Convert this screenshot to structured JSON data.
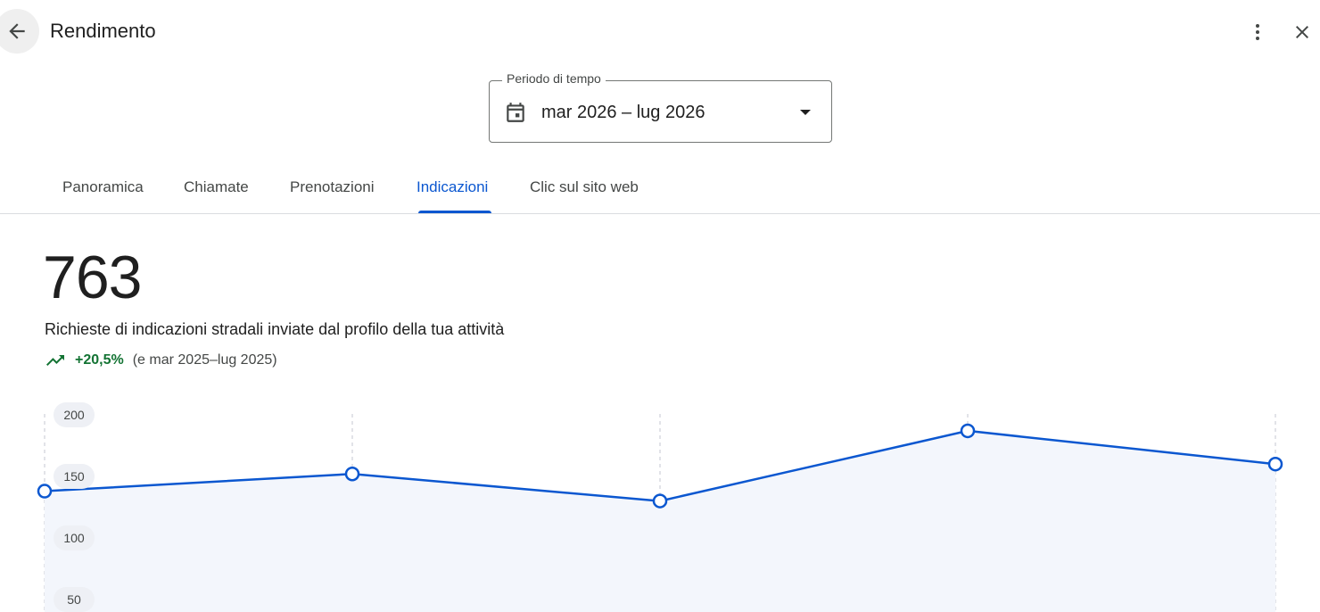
{
  "header": {
    "title": "Rendimento",
    "back_icon": "arrow-left-icon",
    "more_icon": "more-vertical-icon",
    "close_icon": "close-icon"
  },
  "period": {
    "label": "Periodo di tempo",
    "value": "mar 2026 – lug 2026",
    "icon": "calendar-icon"
  },
  "tabs": [
    {
      "label": "Panoramica",
      "active": false
    },
    {
      "label": "Chiamate",
      "active": false
    },
    {
      "label": "Prenotazioni",
      "active": false
    },
    {
      "label": "Indicazioni",
      "active": true
    },
    {
      "label": "Clic sul sito web",
      "active": false
    }
  ],
  "summary": {
    "total": "763",
    "description": "Richieste di indicazioni stradali inviate dal profilo della tua attività",
    "trend_icon": "trending-up-icon",
    "change": "+20,5%",
    "comparison": "(e mar 2025–lug 2025)"
  },
  "colors": {
    "accent": "#0b57d0",
    "positive": "#137333",
    "area_fill": "#f3f6fc",
    "grid": "#c4c7d0"
  },
  "chart_data": {
    "type": "area",
    "x": [
      1,
      2,
      3,
      4,
      5
    ],
    "values": [
      138,
      152,
      130,
      187,
      160
    ],
    "y_ticks": [
      200,
      150,
      100,
      50
    ],
    "ylim": [
      0,
      200
    ],
    "grid": true
  }
}
